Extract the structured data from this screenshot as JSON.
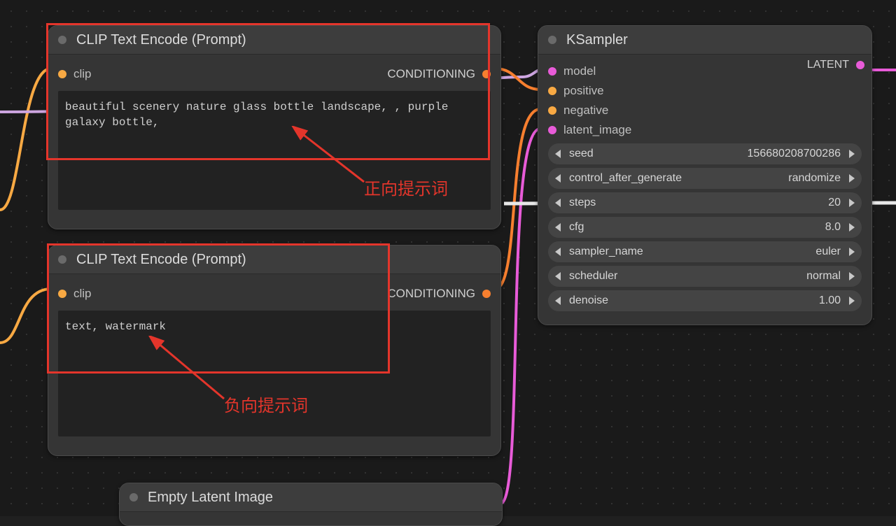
{
  "canvas": {
    "bg": "#1a1a1a"
  },
  "nodes": {
    "positive": {
      "title": "CLIP Text Encode (Prompt)",
      "input_label": "clip",
      "output_label": "CONDITIONING",
      "text": "beautiful scenery nature glass bottle landscape, , purple galaxy bottle,"
    },
    "negative": {
      "title": "CLIP Text Encode (Prompt)",
      "input_label": "clip",
      "output_label": "CONDITIONING",
      "text": "text, watermark"
    },
    "ksampler": {
      "title": "KSampler",
      "inputs": [
        "model",
        "positive",
        "negative",
        "latent_image"
      ],
      "output_label": "LATENT",
      "widgets": [
        {
          "label": "seed",
          "value": "156680208700286"
        },
        {
          "label": "control_after_generate",
          "value": "randomize"
        },
        {
          "label": "steps",
          "value": "20"
        },
        {
          "label": "cfg",
          "value": "8.0"
        },
        {
          "label": "sampler_name",
          "value": "euler"
        },
        {
          "label": "scheduler",
          "value": "normal"
        },
        {
          "label": "denoise",
          "value": "1.00"
        }
      ]
    },
    "empty_latent": {
      "title": "Empty Latent Image"
    }
  },
  "annotations": {
    "positive_label": "正向提示词",
    "negative_label": "负向提示词"
  },
  "port_colors": {
    "clip": "#f8a943",
    "conditioning": "#f77f2f",
    "model": "#e85bd8",
    "latent": "#e85bd8"
  }
}
